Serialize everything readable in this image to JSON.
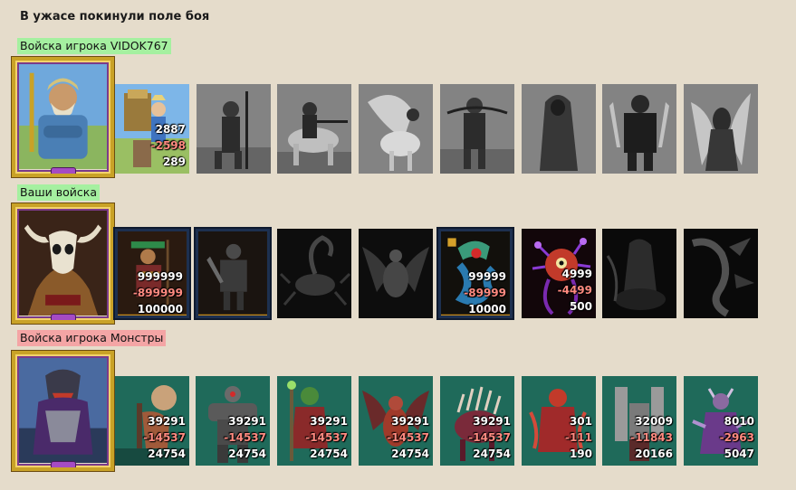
{
  "page_title": "В ужасе покинули поле боя",
  "groups": [
    {
      "label": "Войска игрока VIDOK767",
      "label_color": "#a5f0a0",
      "hero": "hero-portrait-barbarian",
      "units": [
        {
          "name": "peasant-cart-unit",
          "state": "active",
          "count": "2887",
          "lost": "-2598",
          "remaining": "289"
        },
        {
          "name": "pikeman-unit",
          "state": "grayed"
        },
        {
          "name": "cavalier-unit",
          "state": "grayed"
        },
        {
          "name": "pegasus-rider-unit",
          "state": "grayed"
        },
        {
          "name": "crossbowman-unit",
          "state": "grayed"
        },
        {
          "name": "hooded-monk-unit",
          "state": "grayed"
        },
        {
          "name": "armored-warrior-unit",
          "state": "grayed"
        },
        {
          "name": "archangel-unit",
          "state": "grayed"
        }
      ]
    },
    {
      "label": "Ваши войска",
      "label_color": "#a5f0a0",
      "hero": "hero-portrait-minotaur-skull",
      "units": [
        {
          "name": "shaman-unit",
          "state": "framed",
          "count": "999999",
          "lost": "-899999",
          "remaining": "100000"
        },
        {
          "name": "dark-knight-unit",
          "state": "framed"
        },
        {
          "name": "scorpion-unit",
          "state": "grayed"
        },
        {
          "name": "dragon-unit",
          "state": "grayed"
        },
        {
          "name": "serpent-dragon-unit",
          "state": "framed",
          "count": "99999",
          "lost": "-89999",
          "remaining": "10000"
        },
        {
          "name": "beholder-unit",
          "state": "active",
          "count": "4999",
          "lost": "-4499",
          "remaining": "500"
        },
        {
          "name": "shadow-rider-unit",
          "state": "grayed"
        },
        {
          "name": "bone-wyrm-unit",
          "state": "grayed"
        }
      ]
    },
    {
      "label": "Войска игрока Монстры",
      "label_color": "#f4a5a5",
      "hero": "hero-portrait-werebeast",
      "units": [
        {
          "name": "lizard-brute-unit",
          "state": "active",
          "count": "39291",
          "lost": "-14537",
          "remaining": "24754"
        },
        {
          "name": "iron-golem-unit",
          "state": "active",
          "count": "39291",
          "lost": "-14537",
          "remaining": "24754"
        },
        {
          "name": "goblin-shaman-unit",
          "state": "active",
          "count": "39291",
          "lost": "-14537",
          "remaining": "24754"
        },
        {
          "name": "gargoyle-unit",
          "state": "active",
          "count": "39291",
          "lost": "-14537",
          "remaining": "24754"
        },
        {
          "name": "bone-beast-unit",
          "state": "active",
          "count": "39291",
          "lost": "-14537",
          "remaining": "24754"
        },
        {
          "name": "fire-demon-unit",
          "state": "active",
          "count": "301",
          "lost": "-111",
          "remaining": "190"
        },
        {
          "name": "stone-tower-unit",
          "state": "active",
          "count": "32009",
          "lost": "-11843",
          "remaining": "20166"
        },
        {
          "name": "horned-mage-unit",
          "state": "active",
          "count": "8010",
          "lost": "-2963",
          "remaining": "5047"
        }
      ]
    }
  ],
  "colors": {
    "background": "#e5dccb",
    "label_green": "#a5f0a0",
    "label_red": "#f4a5a5",
    "lost_text": "#ff8a80",
    "frame_gold": "#c9a227"
  }
}
